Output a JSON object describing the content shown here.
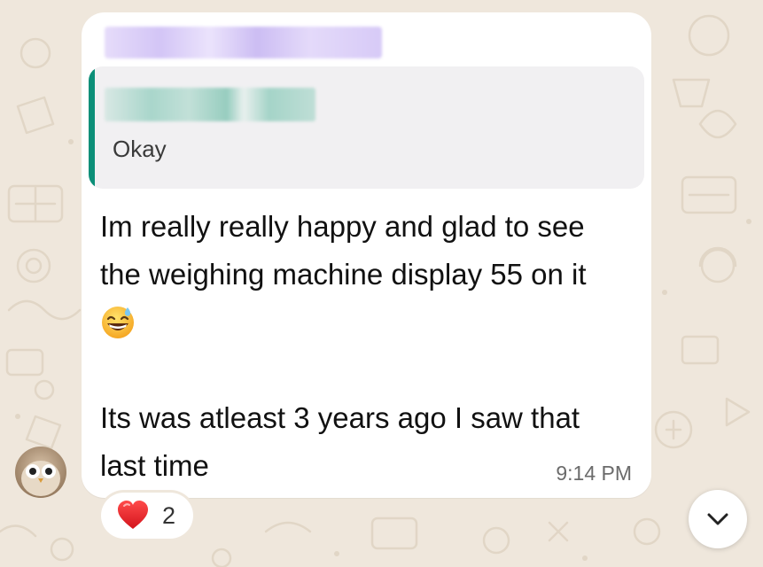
{
  "message": {
    "quoted_text": "Okay",
    "lines": [
      "Im really really happy and glad to see",
      "the weighing machine display 55 on it"
    ],
    "emoji": "grinning-face-with-sweat-emoji",
    "lines_after": [
      "",
      "Its was atleast 3 years ago I saw that",
      "last time"
    ],
    "time": "9:14 PM"
  },
  "reaction": {
    "emoji": "red-heart-emoji",
    "count": "2"
  },
  "icons": {
    "scroll_down": "chevron-down-icon",
    "avatar": "owl-avatar"
  },
  "colors": {
    "wallpaper": "#efe7dc",
    "bubble": "#ffffff",
    "quote_background": "#f1f0f2",
    "quote_bar": "#0c8f78",
    "heart": "#e8202a",
    "timestamp": "#6b6b6b"
  }
}
